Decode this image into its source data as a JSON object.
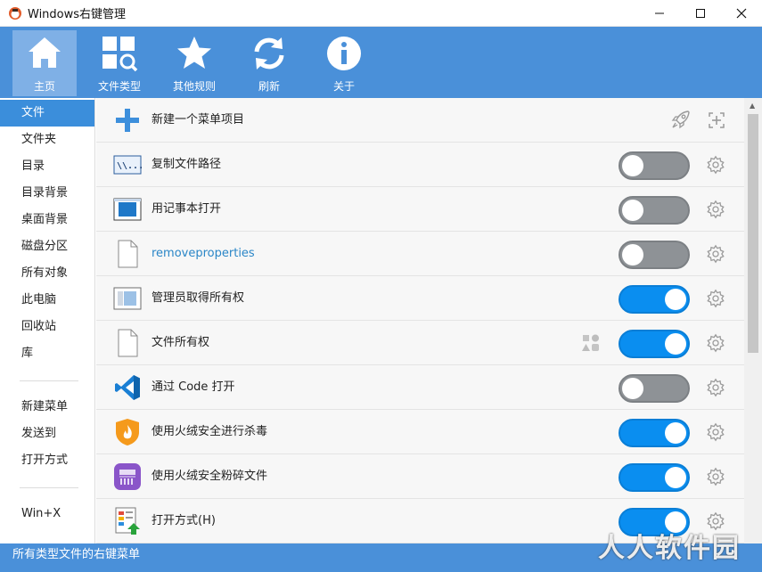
{
  "window": {
    "title": "Windows右键管理",
    "controls": [
      "minimize-icon",
      "maximize-icon",
      "close-icon"
    ]
  },
  "toolbar": {
    "items": [
      {
        "label": "主页",
        "icon": "home-icon",
        "active": true
      },
      {
        "label": "文件类型",
        "icon": "file-type-search-icon",
        "active": false
      },
      {
        "label": "其他规则",
        "icon": "star-icon",
        "active": false
      },
      {
        "label": "刷新",
        "icon": "refresh-icon",
        "active": false
      },
      {
        "label": "关于",
        "icon": "info-icon",
        "active": false
      }
    ]
  },
  "sidebar": {
    "items": [
      {
        "label": "文件",
        "active": true
      },
      {
        "label": "文件夹"
      },
      {
        "label": "目录"
      },
      {
        "label": "目录背景"
      },
      {
        "label": "桌面背景"
      },
      {
        "label": "磁盘分区"
      },
      {
        "label": "所有对象"
      },
      {
        "label": "此电脑"
      },
      {
        "label": "回收站"
      },
      {
        "label": "库"
      }
    ],
    "group2": [
      {
        "label": "新建菜单"
      },
      {
        "label": "发送到"
      },
      {
        "label": "打开方式"
      }
    ],
    "group3": [
      {
        "label": "Win+X"
      }
    ]
  },
  "main": {
    "new_item_label": "新建一个菜单项目",
    "rows": [
      {
        "label": "复制文件路径",
        "icon": "copy-path-icon",
        "enabled": false
      },
      {
        "label": "用记事本打开",
        "icon": "notepad-icon",
        "enabled": false
      },
      {
        "label": "removeproperties",
        "icon": "blank-file-icon",
        "enabled": false,
        "link": true
      },
      {
        "label": "管理员取得所有权",
        "icon": "admin-window-icon",
        "enabled": true
      },
      {
        "label": "文件所有权",
        "icon": "blank-file-icon",
        "enabled": true,
        "extra_icon": "shapes-icon"
      },
      {
        "label": "通过 Code 打开",
        "icon": "vscode-icon",
        "enabled": false
      },
      {
        "label": "使用火绒安全进行杀毒",
        "icon": "huorong-shield-icon",
        "enabled": true
      },
      {
        "label": "使用火绒安全粉碎文件",
        "icon": "shredder-icon",
        "enabled": true
      },
      {
        "label": "打开方式(H)",
        "icon": "open-with-icon",
        "enabled": true
      }
    ]
  },
  "status": {
    "text": "所有类型文件的右键菜单"
  },
  "watermark": "人人软件园",
  "colors": {
    "accent": "#4a90d9",
    "toggle_on": "#0a8ef0",
    "toggle_off": "#8e9296"
  }
}
